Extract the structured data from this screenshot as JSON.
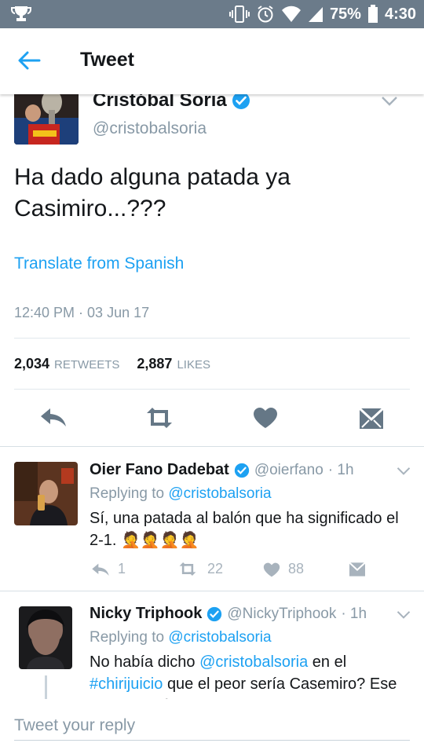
{
  "status_bar": {
    "battery": "75%",
    "time": "4:30",
    "icons": [
      "trophy-icon",
      "vibrate-icon",
      "alarm-icon",
      "wifi-icon",
      "signal-icon",
      "battery-icon"
    ]
  },
  "app_bar": {
    "title": "Tweet",
    "back_icon": "back-arrow-icon"
  },
  "main_tweet": {
    "name": "Cristóbal Soria",
    "handle": "@cristobalsoria",
    "text": "Ha dado alguna patada ya Casimiro...???",
    "translate": "Translate from Spanish",
    "timestamp": "12:40 PM · 03 Jun 17",
    "retweets_count": "2,034",
    "retweets_label": "RETWEETS",
    "likes_count": "2,887",
    "likes_label": "LIKES"
  },
  "replies": [
    {
      "name": "Oier Fano Dadebat",
      "handle": "@oierfano",
      "time": "· 1h",
      "replying_prefix": "Replying to",
      "replying_to": "@cristobalsoria",
      "text": "Sí, una patada al balón que ha significado el 2-1.",
      "emoji": "🤦🤦🤦🤦",
      "reply_count": "1",
      "retweet_count": "22",
      "like_count": "88"
    },
    {
      "name": "Nicky Triphook",
      "handle": "@NickyTriphook",
      "time": "· 1h",
      "replying_prefix": "Replying to",
      "replying_to": "@cristobalsoria",
      "text_1": "No había dicho",
      "mention": "@cristobalsoria",
      "text_2": "en el",
      "hashtag": "#chirijuicio",
      "text_3": "que el peor sería Casemiro?",
      "text_4": "Ese es tu lio más serio"
    }
  ],
  "reply_bar": {
    "placeholder": "Tweet your reply"
  },
  "colors": {
    "accent": "#1da1f2",
    "grey": "#8899a6",
    "status_bar": "#6b7b8a",
    "action_icon": "#657786"
  }
}
